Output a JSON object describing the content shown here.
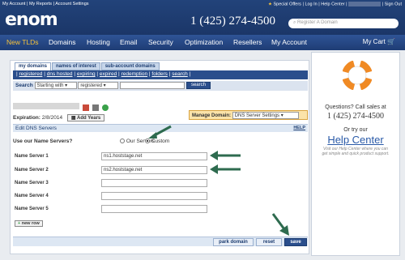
{
  "header": {
    "top_links": [
      "My Account",
      "My Reports",
      "Account Settings"
    ],
    "special_offers": "Special Offers",
    "log_in": "Log In",
    "help_center": "Help Center",
    "sign_out": "Sign Out",
    "logo": "enom",
    "phone": "1 (425) 274-4500",
    "search_placeholder": "Register A Domain"
  },
  "nav": {
    "items": [
      "New TLDs",
      "Domains",
      "Hosting",
      "Email",
      "Security",
      "Optimization",
      "Resellers",
      "My Account"
    ],
    "active": "New TLDs",
    "cart": "My Cart"
  },
  "tabs": [
    "my domains",
    "names of interest",
    "sub-account domains"
  ],
  "subnav": [
    "registered",
    "dns hosted",
    "expiring",
    "expired",
    "redemption",
    "folders",
    "search"
  ],
  "search": {
    "label": "Search",
    "mode": "Starting with",
    "scope": "registered",
    "button": "search"
  },
  "domain": {
    "expiration_label": "Expiration:",
    "expiration_date": "2/8/2014",
    "add_years": "Add Years",
    "manage_label": "Manage Domain:",
    "manage_value": "DNS Server Settings"
  },
  "section": {
    "title": "Edit DNS Servers",
    "help": "HELP",
    "use_question": "Use our Name Servers?",
    "option_ours": "Our Servers",
    "option_custom": "Custom"
  },
  "name_servers": [
    {
      "label": "Name Server 1",
      "value": "ns1.hoststage.net"
    },
    {
      "label": "Name Server 2",
      "value": "ns2.hoststage.net"
    },
    {
      "label": "Name Server 3",
      "value": ""
    },
    {
      "label": "Name Server 4",
      "value": ""
    },
    {
      "label": "Name Server 5",
      "value": ""
    }
  ],
  "new_row": "new row",
  "buttons": {
    "park": "park domain",
    "reset": "reset",
    "save": "save"
  },
  "sidebar": {
    "questions": "Questions? Call sales at",
    "phone": "1 (425) 274-4500",
    "or_try": "Or try our",
    "help_center": "Help Center",
    "help_desc": "Visit our Help Center where you can get simple and quick product support."
  },
  "colors": {
    "header": "#1b3668",
    "nav": "#2f5496",
    "accent": "#f6c23a",
    "arrow": "#2e6b4f"
  }
}
